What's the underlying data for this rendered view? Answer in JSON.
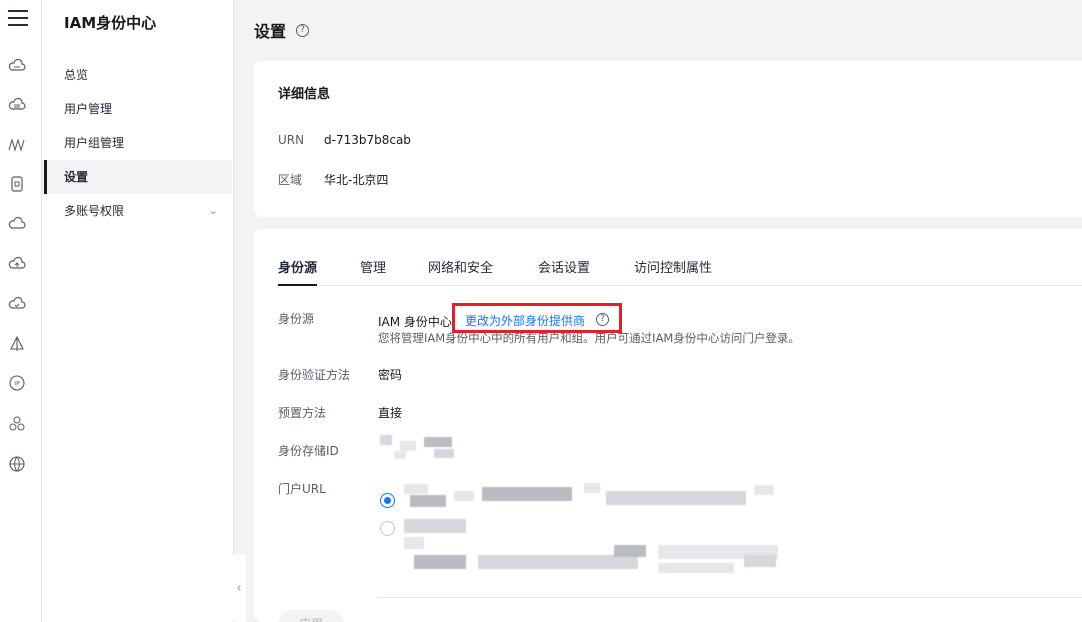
{
  "app": {
    "title": "IAM身份中心"
  },
  "rail": {
    "icons": [
      "menu-icon",
      "cloud-icon",
      "cloud-server-icon",
      "waves-icon",
      "phone-icon",
      "cloud-outline-icon",
      "cloud-upload-icon",
      "cloud-check-icon",
      "sail-icon",
      "ip-icon",
      "cluster-icon",
      "globe-icon"
    ]
  },
  "sidebar": {
    "items": [
      {
        "label": "总览"
      },
      {
        "label": "用户管理"
      },
      {
        "label": "用户组管理"
      },
      {
        "label": "设置",
        "active": true
      },
      {
        "label": "多账号权限",
        "expandable": true
      }
    ]
  },
  "page": {
    "title": "设置",
    "help": "?"
  },
  "details": {
    "title": "详细信息",
    "urn_label": "URN",
    "urn_value": "d-713b7b8cab",
    "region_label": "区域",
    "region_value": "华北-北京四"
  },
  "tabs": [
    {
      "label": "身份源",
      "active": true
    },
    {
      "label": "管理"
    },
    {
      "label": "网络和安全"
    },
    {
      "label": "会话设置"
    },
    {
      "label": "访问控制属性"
    }
  ],
  "identity": {
    "source_label": "身份源",
    "source_value": "IAM 身份中心",
    "change_link": "更改为外部身份提供商",
    "description": "您将管理IAM身份中心中的所有用户和组。用户可通过IAM身份中心访问门户登录。",
    "auth_label": "身份验证方法",
    "auth_value": "密码",
    "provision_label": "预置方法",
    "provision_value": "直接",
    "store_label": "身份存储ID",
    "portal_label": "门户URL"
  },
  "actions": {
    "apply": "应用"
  },
  "colors": {
    "accent": "#1476ff",
    "highlight": "#e0202e"
  }
}
